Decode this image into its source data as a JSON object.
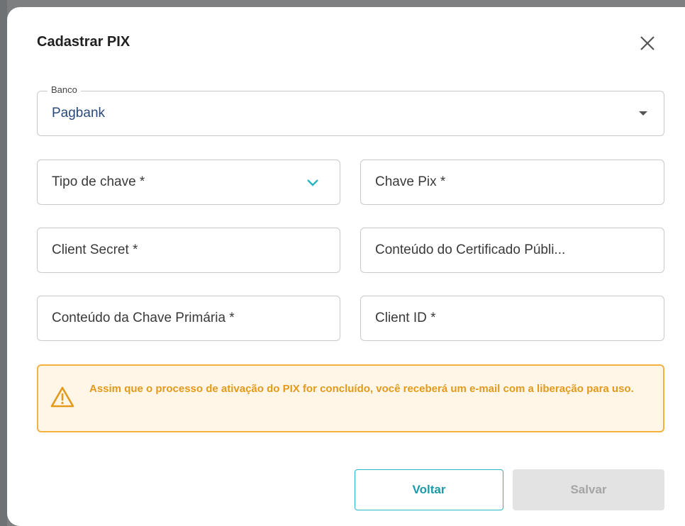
{
  "dialog": {
    "title": "Cadastrar PIX",
    "close_icon": "close-icon"
  },
  "form": {
    "banco": {
      "label": "Banco",
      "value": "Pagbank"
    },
    "tipo_chave": {
      "placeholder": "Tipo de chave *"
    },
    "chave_pix": {
      "placeholder": "Chave Pix *"
    },
    "client_secret": {
      "placeholder": "Client Secret *"
    },
    "certificado_publico": {
      "placeholder": "Conteúdo do Certificado Públi..."
    },
    "chave_primaria": {
      "placeholder": "Conteúdo da Chave Primária *"
    },
    "client_id": {
      "placeholder": "Client ID *"
    }
  },
  "alert": {
    "icon": "warning-icon",
    "text": "Assim que o processo de ativação do PIX for concluído, você receberá um e-mail com a liberação para uso."
  },
  "actions": {
    "back_label": "Voltar",
    "save_label": "Salvar"
  },
  "colors": {
    "accent": "#27b6c2",
    "warning": "#f3b13d",
    "warning_bg": "#fff6e8",
    "disabled": "#e3e3e3"
  }
}
